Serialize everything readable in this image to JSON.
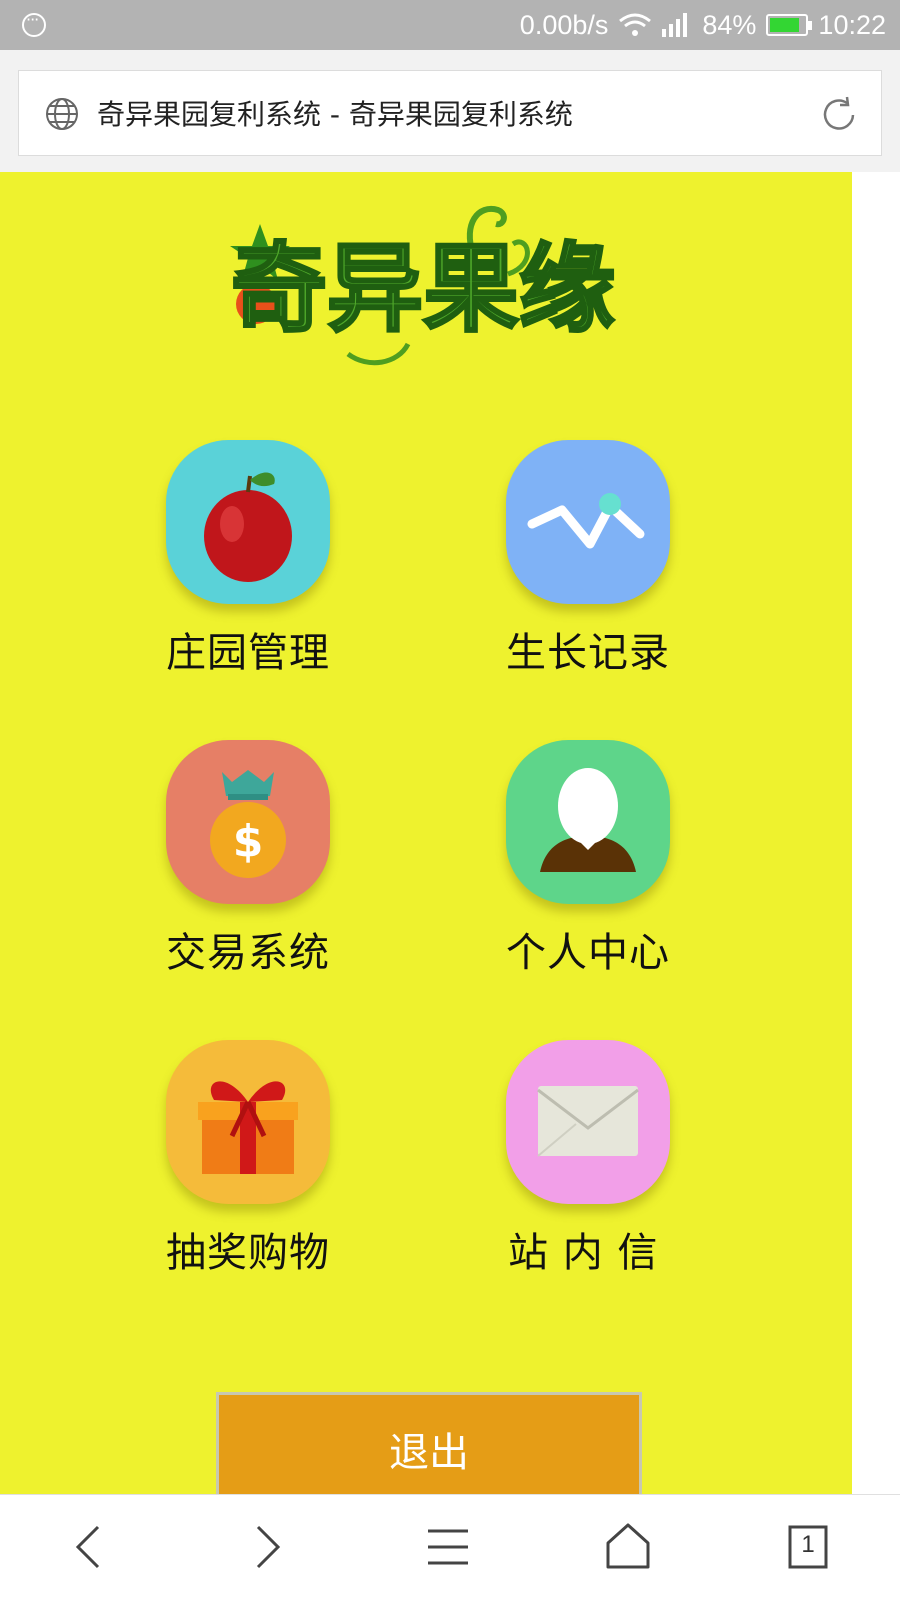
{
  "status_bar": {
    "network_speed": "0.00b/s",
    "battery_percent": "84%",
    "battery_level": 0.84,
    "time": "10:22"
  },
  "address_bar": {
    "title": "奇异果园复利系统 - 奇异果园复利系统"
  },
  "logo": {
    "text": "奇异果缘"
  },
  "menu": {
    "items": [
      {
        "label": "庄园管理",
        "icon": "apple-icon",
        "color": "#5ad2d8"
      },
      {
        "label": "生长记录",
        "icon": "growth-chart-icon",
        "color": "#7fb2f6"
      },
      {
        "label": "交易系统",
        "icon": "money-bag-icon",
        "color": "#e67f66"
      },
      {
        "label": "个人中心",
        "icon": "user-avatar-icon",
        "color": "#5ed58a"
      },
      {
        "label": "抽奖购物",
        "icon": "gift-icon",
        "color": "#f5bb3a"
      },
      {
        "label": "站 内 信",
        "icon": "envelope-icon",
        "color": "#f29fe8"
      }
    ]
  },
  "logout": {
    "label": "退出"
  },
  "bottom_nav": {
    "tab_count": "1"
  },
  "colors": {
    "page_background": "#eef22e",
    "logout_button": "#e59d16",
    "status_bar": "#b3b3b3"
  }
}
